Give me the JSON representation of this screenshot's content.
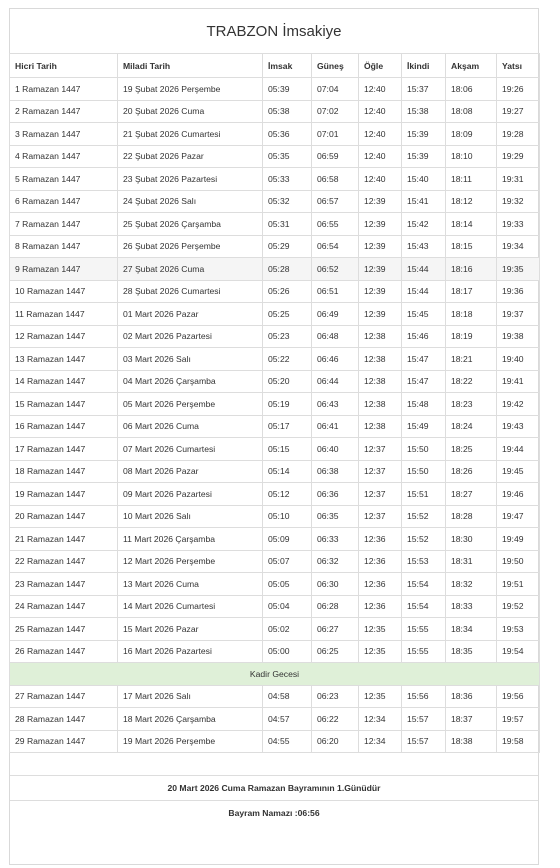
{
  "title": "TRABZON İmsakiye",
  "headers": [
    "Hicri Tarih",
    "Miladi Tarih",
    "İmsak",
    "Güneş",
    "Öğle",
    "İkindi",
    "Akşam",
    "Yatsı"
  ],
  "rows": [
    [
      "1 Ramazan 1447",
      "19 Şubat 2026 Perşembe",
      "05:39",
      "07:04",
      "12:40",
      "15:37",
      "18:06",
      "19:26"
    ],
    [
      "2 Ramazan 1447",
      "20 Şubat 2026 Cuma",
      "05:38",
      "07:02",
      "12:40",
      "15:38",
      "18:08",
      "19:27"
    ],
    [
      "3 Ramazan 1447",
      "21 Şubat 2026 Cumartesi",
      "05:36",
      "07:01",
      "12:40",
      "15:39",
      "18:09",
      "19:28"
    ],
    [
      "4 Ramazan 1447",
      "22 Şubat 2026 Pazar",
      "05:35",
      "06:59",
      "12:40",
      "15:39",
      "18:10",
      "19:29"
    ],
    [
      "5 Ramazan 1447",
      "23 Şubat 2026 Pazartesi",
      "05:33",
      "06:58",
      "12:40",
      "15:40",
      "18:11",
      "19:31"
    ],
    [
      "6 Ramazan 1447",
      "24 Şubat 2026 Salı",
      "05:32",
      "06:57",
      "12:39",
      "15:41",
      "18:12",
      "19:32"
    ],
    [
      "7 Ramazan 1447",
      "25 Şubat 2026 Çarşamba",
      "05:31",
      "06:55",
      "12:39",
      "15:42",
      "18:14",
      "19:33"
    ],
    [
      "8 Ramazan 1447",
      "26 Şubat 2026 Perşembe",
      "05:29",
      "06:54",
      "12:39",
      "15:43",
      "18:15",
      "19:34"
    ],
    [
      "9 Ramazan 1447",
      "27 Şubat 2026 Cuma",
      "05:28",
      "06:52",
      "12:39",
      "15:44",
      "18:16",
      "19:35"
    ],
    [
      "10 Ramazan 1447",
      "28 Şubat 2026 Cumartesi",
      "05:26",
      "06:51",
      "12:39",
      "15:44",
      "18:17",
      "19:36"
    ],
    [
      "11 Ramazan 1447",
      "01 Mart 2026 Pazar",
      "05:25",
      "06:49",
      "12:39",
      "15:45",
      "18:18",
      "19:37"
    ],
    [
      "12 Ramazan 1447",
      "02 Mart 2026 Pazartesi",
      "05:23",
      "06:48",
      "12:38",
      "15:46",
      "18:19",
      "19:38"
    ],
    [
      "13 Ramazan 1447",
      "03 Mart 2026 Salı",
      "05:22",
      "06:46",
      "12:38",
      "15:47",
      "18:21",
      "19:40"
    ],
    [
      "14 Ramazan 1447",
      "04 Mart 2026 Çarşamba",
      "05:20",
      "06:44",
      "12:38",
      "15:47",
      "18:22",
      "19:41"
    ],
    [
      "15 Ramazan 1447",
      "05 Mart 2026 Perşembe",
      "05:19",
      "06:43",
      "12:38",
      "15:48",
      "18:23",
      "19:42"
    ],
    [
      "16 Ramazan 1447",
      "06 Mart 2026 Cuma",
      "05:17",
      "06:41",
      "12:38",
      "15:49",
      "18:24",
      "19:43"
    ],
    [
      "17 Ramazan 1447",
      "07 Mart 2026 Cumartesi",
      "05:15",
      "06:40",
      "12:37",
      "15:50",
      "18:25",
      "19:44"
    ],
    [
      "18 Ramazan 1447",
      "08 Mart 2026 Pazar",
      "05:14",
      "06:38",
      "12:37",
      "15:50",
      "18:26",
      "19:45"
    ],
    [
      "19 Ramazan 1447",
      "09 Mart 2026 Pazartesi",
      "05:12",
      "06:36",
      "12:37",
      "15:51",
      "18:27",
      "19:46"
    ],
    [
      "20 Ramazan 1447",
      "10 Mart 2026 Salı",
      "05:10",
      "06:35",
      "12:37",
      "15:52",
      "18:28",
      "19:47"
    ],
    [
      "21 Ramazan 1447",
      "11 Mart 2026 Çarşamba",
      "05:09",
      "06:33",
      "12:36",
      "15:52",
      "18:30",
      "19:49"
    ],
    [
      "22 Ramazan 1447",
      "12 Mart 2026 Perşembe",
      "05:07",
      "06:32",
      "12:36",
      "15:53",
      "18:31",
      "19:50"
    ],
    [
      "23 Ramazan 1447",
      "13 Mart 2026 Cuma",
      "05:05",
      "06:30",
      "12:36",
      "15:54",
      "18:32",
      "19:51"
    ],
    [
      "24 Ramazan 1447",
      "14 Mart 2026 Cumartesi",
      "05:04",
      "06:28",
      "12:36",
      "15:54",
      "18:33",
      "19:52"
    ],
    [
      "25 Ramazan 1447",
      "15 Mart 2026 Pazar",
      "05:02",
      "06:27",
      "12:35",
      "15:55",
      "18:34",
      "19:53"
    ],
    [
      "26 Ramazan 1447",
      "16 Mart 2026 Pazartesi",
      "05:00",
      "06:25",
      "12:35",
      "15:55",
      "18:35",
      "19:54"
    ],
    [
      "Kadir Gecesi"
    ],
    [
      "27 Ramazan 1447",
      "17 Mart 2026 Salı",
      "04:58",
      "06:23",
      "12:35",
      "15:56",
      "18:36",
      "19:56"
    ],
    [
      "28 Ramazan 1447",
      "18 Mart 2026 Çarşamba",
      "04:57",
      "06:22",
      "12:34",
      "15:57",
      "18:37",
      "19:57"
    ],
    [
      "29 Ramazan 1447",
      "19 Mart 2026 Perşembe",
      "04:55",
      "06:20",
      "12:34",
      "15:57",
      "18:38",
      "19:58"
    ]
  ],
  "highlight_row_index": 8,
  "footer": {
    "bayram_text": "20 Mart 2026 Cuma Ramazan Bayramının 1.Günüdür",
    "namaz_text": "Bayram Namazı :06:56"
  },
  "colors": {
    "kadir_bg": "#dff0d8",
    "highlight_bg": "#f5f5f5",
    "border": "#dddddd"
  }
}
